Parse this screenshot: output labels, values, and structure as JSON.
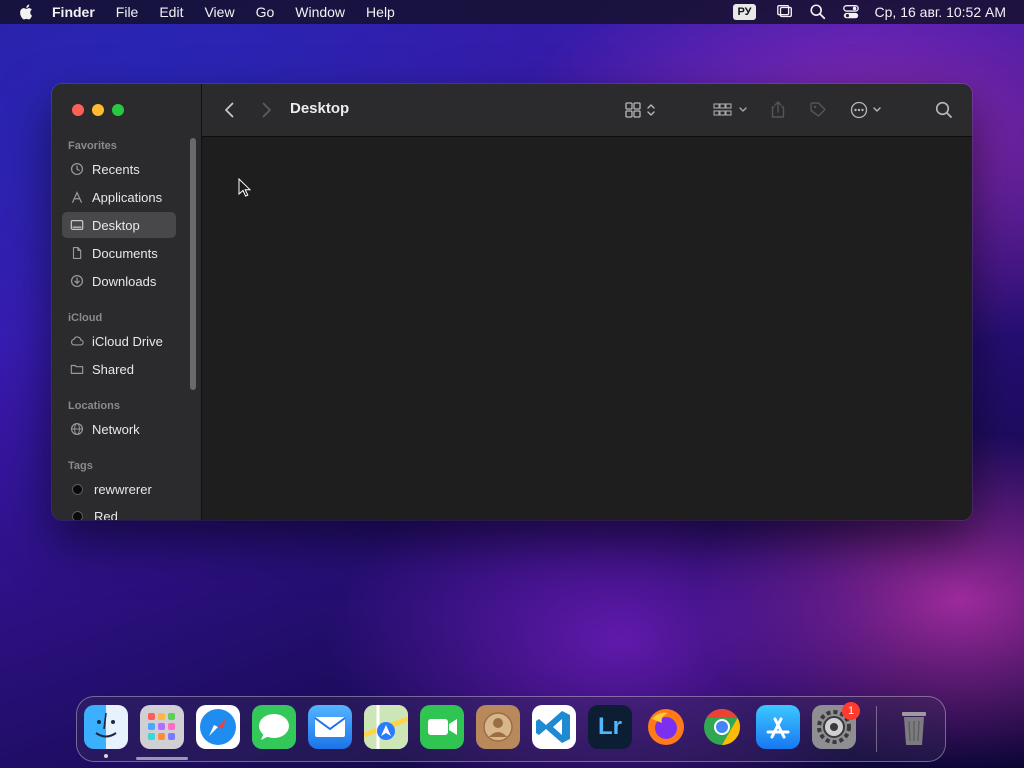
{
  "menubar": {
    "app_name": "Finder",
    "items": [
      "File",
      "Edit",
      "View",
      "Go",
      "Window",
      "Help"
    ],
    "input_language": "РУ",
    "clock": "Ср, 16 авг.  10:52 AM"
  },
  "window": {
    "title": "Desktop",
    "sidebar": {
      "favorites_title": "Favorites",
      "favorites": [
        {
          "label": "Recents",
          "icon": "clock-icon"
        },
        {
          "label": "Applications",
          "icon": "applications-icon"
        },
        {
          "label": "Desktop",
          "icon": "desktop-icon",
          "selected": true
        },
        {
          "label": "Documents",
          "icon": "document-icon"
        },
        {
          "label": "Downloads",
          "icon": "download-icon"
        }
      ],
      "icloud_title": "iCloud",
      "icloud": [
        {
          "label": "iCloud Drive",
          "icon": "cloud-icon"
        },
        {
          "label": "Shared",
          "icon": "shared-folder-icon"
        }
      ],
      "locations_title": "Locations",
      "locations": [
        {
          "label": "Network",
          "icon": "globe-icon"
        }
      ],
      "tags_title": "Tags",
      "tags": [
        {
          "label": "rewwrerer",
          "color": "#0a0a0a"
        },
        {
          "label": "Red",
          "color": "#0a0a0a"
        }
      ]
    }
  },
  "dock": {
    "apps": [
      "Finder",
      "Launchpad",
      "Safari",
      "Messages",
      "Mail",
      "Maps",
      "FaceTime",
      "Contacts",
      "Visual Studio Code",
      "Lightroom",
      "Firefox",
      "Chrome",
      "App Store",
      "System Settings",
      "Trash"
    ],
    "lightroom_label": "Lr",
    "settings_badge": "1"
  }
}
